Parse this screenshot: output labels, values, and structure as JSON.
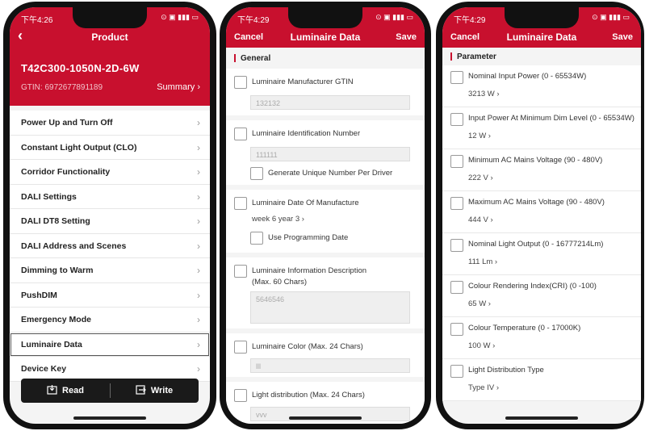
{
  "status": {
    "screen1_time": "下午4:26",
    "screen2_time": "下午4:29",
    "screen3_time": "下午4:29",
    "sys": "⊙ ▣ ▮▮▮ ▭"
  },
  "product": {
    "back_label": "‹",
    "title": "Product",
    "model": "T42C300-1050N-2D-6W",
    "gtin": "GTIN: 6972677891189",
    "summary_label": "Summary ›",
    "menu": [
      {
        "label": "Power Up and Turn Off"
      },
      {
        "label": "Constant Light Output (CLO)"
      },
      {
        "label": "Corridor Functionality"
      },
      {
        "label": "DALI Settings"
      },
      {
        "label": "DALI DT8 Setting"
      },
      {
        "label": "DALI Address and Scenes"
      },
      {
        "label": "Dimming to Warm"
      },
      {
        "label": "PushDIM"
      },
      {
        "label": "Emergency Mode"
      },
      {
        "label": "Luminaire Data"
      },
      {
        "label": "Device Key"
      }
    ],
    "read_label": "Read",
    "write_label": "Write",
    "chevron": "›"
  },
  "luminaire_general": {
    "cancel_label": "Cancel",
    "title": "Luminaire Data",
    "save_label": "Save",
    "section": "General",
    "gtin_label": "Luminaire Manufacturer GTIN",
    "gtin_value": "132132",
    "id_label": "Luminaire Identification Number",
    "id_value": "111111",
    "generate_label": "Generate Unique Number Per Driver",
    "date_label": "Luminaire Date Of Manufacture",
    "date_value": "week 6 year 3 ›",
    "use_prog_label": "Use Programming Date",
    "info_label_1": "Luminaire Information Description",
    "info_label_2": "(Max. 60 Chars)",
    "info_value": "5646546",
    "color_label": "Luminaire Color (Max. 24 Chars)",
    "color_value": "lll",
    "dist_label": "Light distribution (Max. 24 Chars)",
    "dist_value": "vvv"
  },
  "luminaire_param": {
    "cancel_label": "Cancel",
    "title": "Luminaire Data",
    "save_label": "Save",
    "section": "Parameter",
    "params": [
      {
        "name": "Nominal Input Power (0 - 65534W)",
        "value": "3213 W ›"
      },
      {
        "name": "Input Power At Minimum Dim Level (0 - 65534W)",
        "value": "12 W ›"
      },
      {
        "name": "Minimum AC Mains Voltage (90 - 480V)",
        "value": "222 V ›"
      },
      {
        "name": "Maximum AC Mains Voltage (90 - 480V)",
        "value": "444 V ›"
      },
      {
        "name": "Nominal Light Output (0 - 16777214Lm)",
        "value": "111 Lm ›"
      },
      {
        "name": "Colour Rendering Index(CRI) (0 -100)",
        "value": "65 W ›"
      },
      {
        "name": "Colour Temperature (0 - 17000K)",
        "value": "100 W ›"
      },
      {
        "name": "Light Distribution Type",
        "value": "Type IV ›"
      }
    ]
  },
  "colors": {
    "brand_red": "#c8102e",
    "dark": "#1a1a1a"
  }
}
